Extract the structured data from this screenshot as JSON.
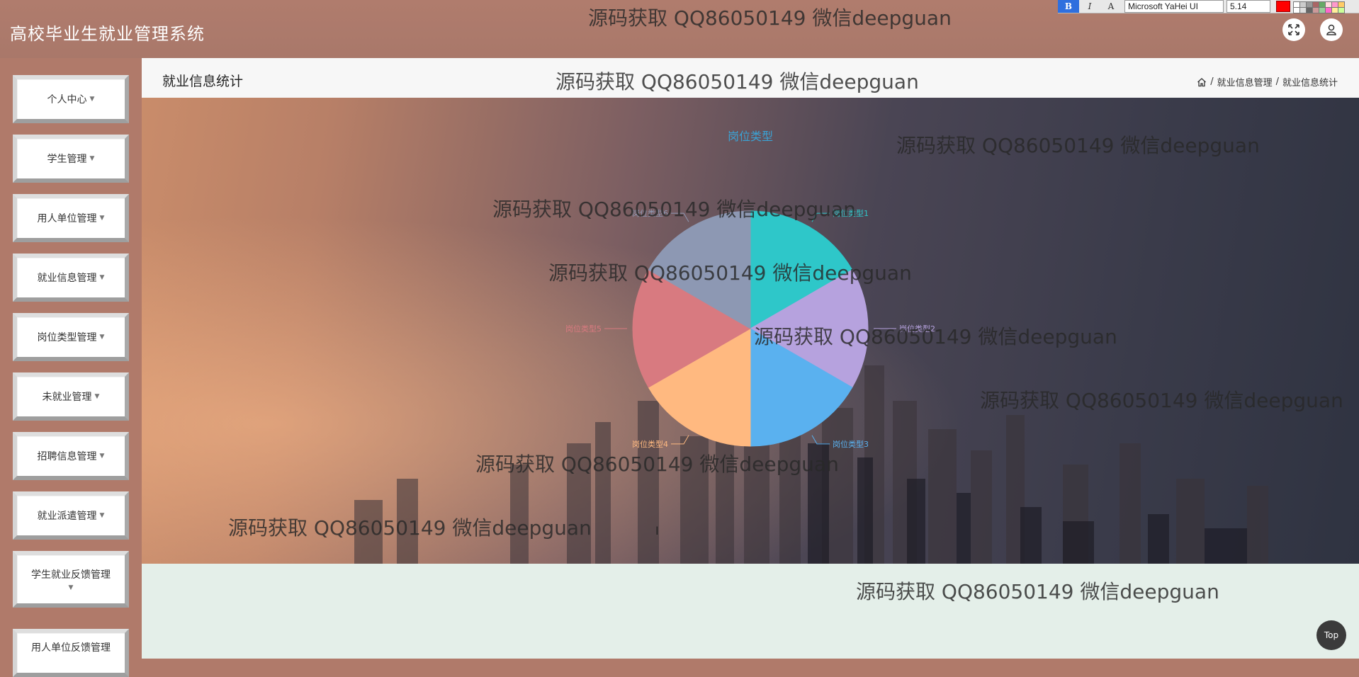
{
  "app": {
    "title": "高校毕业生就业管理系统"
  },
  "toolbar": {
    "bold": "B",
    "italic": "I",
    "format": "A",
    "font": "Microsoft YaHei UI",
    "size": "5.14"
  },
  "sidebar": {
    "items": [
      {
        "label": "个人中心"
      },
      {
        "label": "学生管理"
      },
      {
        "label": "用人单位管理"
      },
      {
        "label": "就业信息管理"
      },
      {
        "label": "岗位类型管理"
      },
      {
        "label": "未就业管理"
      },
      {
        "label": "招聘信息管理"
      },
      {
        "label": "就业派遣管理"
      },
      {
        "label": "学生就业反馈管理"
      },
      {
        "label": "用人单位反馈管理"
      }
    ]
  },
  "header": {
    "page_title": "就业信息统计",
    "breadcrumb": [
      "就业信息管理",
      "就业信息统计"
    ]
  },
  "watermark_text": "源码获取 QQ86050149 微信deepguan",
  "top_button": "Top",
  "colors": {
    "slice1": "#2ec7c9",
    "slice2": "#b6a2de",
    "slice3": "#5ab1ef",
    "slice4": "#ffb980",
    "slice5": "#d87a80",
    "slice6": "#8d98b3"
  },
  "chart_data": {
    "type": "pie",
    "title": "岗位类型",
    "categories": [
      "岗位类型1",
      "岗位类型2",
      "岗位类型3",
      "岗位类型4",
      "岗位类型5",
      "岗位类型6"
    ],
    "values": [
      1,
      1,
      1,
      1,
      1,
      1
    ]
  }
}
